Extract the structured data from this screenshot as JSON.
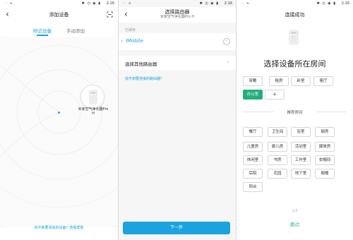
{
  "status_bar": {
    "left": "·· ≈",
    "icons": "✱ ◷ ◉ ▮",
    "time": "2:16"
  },
  "screen1": {
    "title": "添加设备",
    "tabs": [
      {
        "label": "附近设备",
        "active": true
      },
      {
        "label": "手动添加",
        "active": false
      }
    ],
    "device_label": "米家空气净化器Pro H",
    "help_link": "找不到要添加的设备？查看帮助"
  },
  "screen2": {
    "title": "选择路由器",
    "subtitle": "米家空气净化器Pro H",
    "saved_label": "已保存",
    "saved_router": "iMobile",
    "more_glyph": "···",
    "other_router": "选择其他路由器",
    "cant_find": "找不到要连接的路由器？",
    "next_button": "下一步"
  },
  "screen3": {
    "title": "连接成功",
    "heading": "选择设备所在房间",
    "rooms": [
      "穿戴",
      "租房",
      "卧室",
      "客厅",
      "办公室"
    ],
    "selected_room": "办公室",
    "add_glyph": "+",
    "recommended_label": "推荐房间",
    "recommended": [
      "餐厅",
      "卫生间",
      "浴室",
      "厨房",
      "儿童房",
      "婴儿房",
      "活动室",
      "媒体房",
      "休闲室",
      "书房",
      "工作室",
      "衣帽间",
      "后院",
      "花园",
      "地下室",
      "阁楼",
      "阳台"
    ],
    "pager": "1/3",
    "skip": "跳过"
  },
  "colors": {
    "accent_blue": "#1ba3e0",
    "accent_green": "#21b07a"
  },
  "icons": {
    "back": "chevron-left-icon",
    "scan": "scan-icon",
    "arrow": "chevron-right-icon"
  }
}
